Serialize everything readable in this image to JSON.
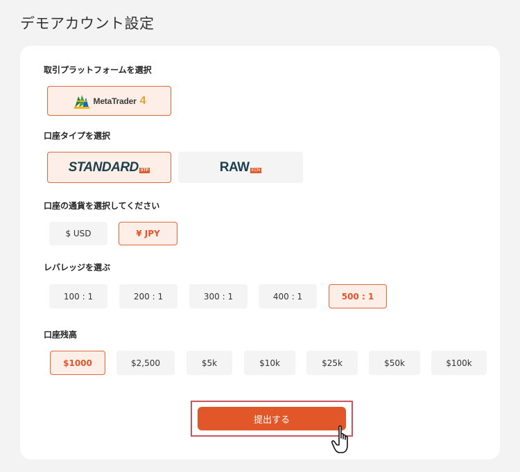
{
  "page": {
    "title": "デモアカウント設定"
  },
  "platform": {
    "label": "取引プラットフォームを選択",
    "options": [
      {
        "name": "MetaTrader",
        "version": "4",
        "selected": true,
        "icon": "metatrader-icon"
      }
    ]
  },
  "account_type": {
    "label": "口座タイプを選択",
    "options": [
      {
        "word": "STANDARD",
        "tag": "STP",
        "selected": true
      },
      {
        "word": "RAW",
        "tag": "ECN",
        "selected": false
      }
    ]
  },
  "currency": {
    "label": "口座の通貨を選択してください",
    "options": [
      {
        "text": "$ USD",
        "selected": false
      },
      {
        "text": "¥ JPY",
        "selected": true
      }
    ]
  },
  "leverage": {
    "label": "レバレッジを選ぶ",
    "options": [
      {
        "text": "100 : 1",
        "selected": false
      },
      {
        "text": "200 : 1",
        "selected": false
      },
      {
        "text": "300 : 1",
        "selected": false
      },
      {
        "text": "400 : 1",
        "selected": false
      },
      {
        "text": "500 : 1",
        "selected": true
      }
    ]
  },
  "balance": {
    "label": "口座残高",
    "options": [
      {
        "text": "$1000",
        "selected": true
      },
      {
        "text": "$2,500",
        "selected": false
      },
      {
        "text": "$5k",
        "selected": false
      },
      {
        "text": "$10k",
        "selected": false
      },
      {
        "text": "$25k",
        "selected": false
      },
      {
        "text": "$50k",
        "selected": false
      },
      {
        "text": "$100k",
        "selected": false
      }
    ]
  },
  "submit": {
    "label": "提出する"
  },
  "colors": {
    "accent": "#e2572a",
    "selected_bg": "#fdeee7",
    "highlight_frame": "#c9535f",
    "logo_dark": "#1c3f4d"
  }
}
